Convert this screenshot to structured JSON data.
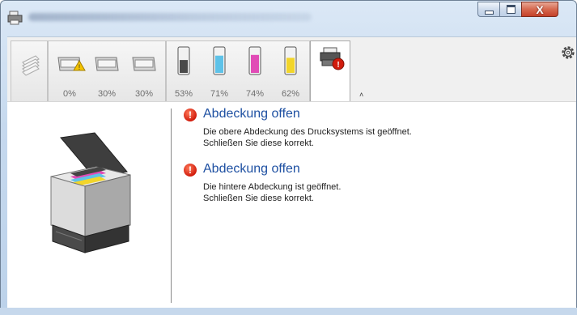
{
  "window": {
    "title": "Kyocera TASKalfa — Status Monitor",
    "controls": {
      "minimize_icon": "minimize-icon",
      "maximize_icon": "maximize-icon",
      "close_icon": "close-icon"
    }
  },
  "toolbar": {
    "trays": [
      {
        "label": "0%",
        "level": 0,
        "warning": true
      },
      {
        "label": "30%",
        "level": 30,
        "warning": false
      },
      {
        "label": "30%",
        "level": 30,
        "warning": false
      }
    ],
    "toners": [
      {
        "label": "53%",
        "level": 53,
        "color": "#4a4a4a"
      },
      {
        "label": "71%",
        "level": 71,
        "color": "#5ec2e8"
      },
      {
        "label": "74%",
        "level": 74,
        "color": "#e14bb6"
      },
      {
        "label": "62%",
        "level": 62,
        "color": "#f2d52a"
      }
    ],
    "collapse_glyph": "˄",
    "gear_icon": "gear-icon"
  },
  "status": {
    "messages": [
      {
        "title": "Abdeckung offen",
        "lines": [
          "Die obere Abdeckung des Drucksystems ist geöffnet.",
          "Schließen Sie diese korrekt."
        ]
      },
      {
        "title": "Abdeckung offen",
        "lines": [
          "Die hintere Abdeckung ist geöffnet.",
          "Schließen Sie diese korrekt."
        ]
      }
    ],
    "alert_glyph": "!"
  },
  "colors": {
    "error_red": "#d11c0c",
    "title_blue": "#1e50a2",
    "warning_yellow": "#f5c400"
  }
}
